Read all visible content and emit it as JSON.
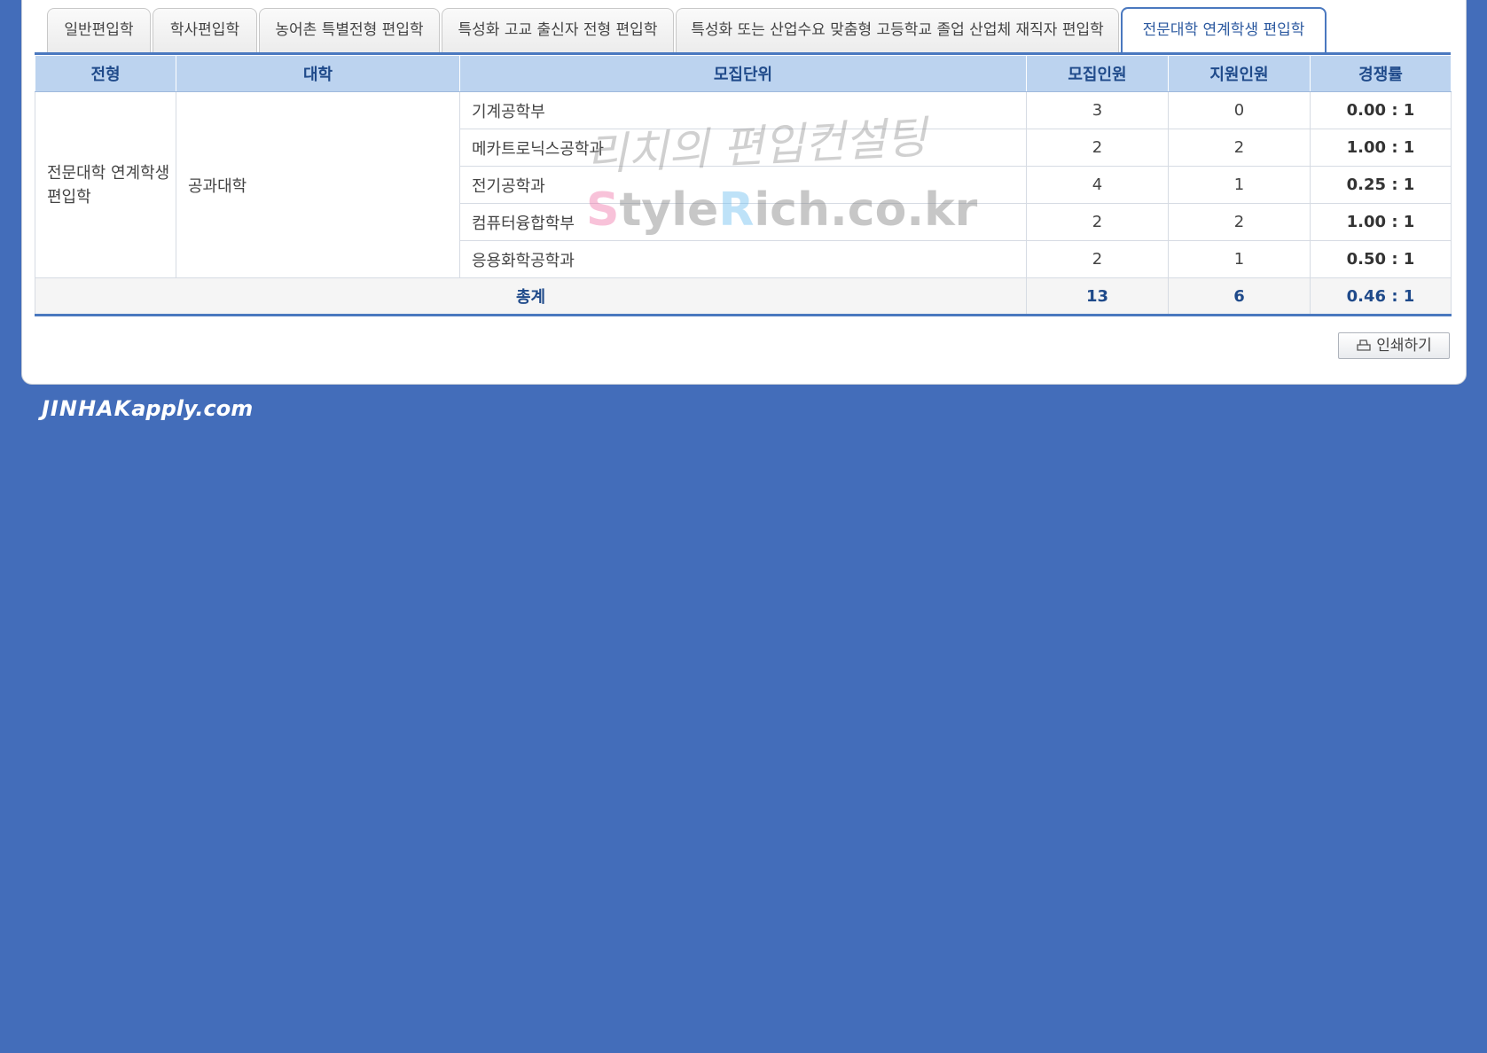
{
  "tabs": [
    {
      "label": "일반편입학",
      "active": false
    },
    {
      "label": "학사편입학",
      "active": false
    },
    {
      "label": "농어촌 특별전형 편입학",
      "active": false
    },
    {
      "label": "특성화 고교 출신자 전형 편입학",
      "active": false
    },
    {
      "label": "특성화 또는 산업수요 맞춤형 고등학교 졸업 산업체 재직자 편입학",
      "active": false
    },
    {
      "label": "전문대학 연계학생 편입학",
      "active": true
    }
  ],
  "table": {
    "headers": {
      "type": "전형",
      "college": "대학",
      "unit": "모집단위",
      "quota": "모집인원",
      "applicants": "지원인원",
      "ratio": "경쟁률"
    },
    "type_value": "전문대학 연계학생 편입학",
    "college_value": "공과대학",
    "rows": [
      {
        "unit": "기계공학부",
        "quota": "3",
        "applicants": "0",
        "ratio": "0.00 : 1"
      },
      {
        "unit": "메카트로닉스공학과",
        "quota": "2",
        "applicants": "2",
        "ratio": "1.00 : 1"
      },
      {
        "unit": "전기공학과",
        "quota": "4",
        "applicants": "1",
        "ratio": "0.25 : 1"
      },
      {
        "unit": "컴퓨터융합학부",
        "quota": "2",
        "applicants": "2",
        "ratio": "1.00 : 1"
      },
      {
        "unit": "응용화학공학과",
        "quota": "2",
        "applicants": "1",
        "ratio": "0.50 : 1"
      }
    ],
    "total": {
      "label": "총계",
      "quota": "13",
      "applicants": "6",
      "ratio": "0.46 : 1"
    }
  },
  "print_button": {
    "label": "인쇄하기",
    "icon": "print-icon"
  },
  "watermark": {
    "script": "리치의 편입컨설팅",
    "url_s": "S",
    "url_tyle": "tyle",
    "url_r": "R",
    "url_rest": "ich.co.kr"
  },
  "logo": {
    "brand": "JINHAK",
    "suffix": "apply.com"
  },
  "colors": {
    "page_background": "#436dba",
    "header_background": "#bcd3ef",
    "accent": "#4a78bf",
    "header_text": "#1f4a8a"
  }
}
